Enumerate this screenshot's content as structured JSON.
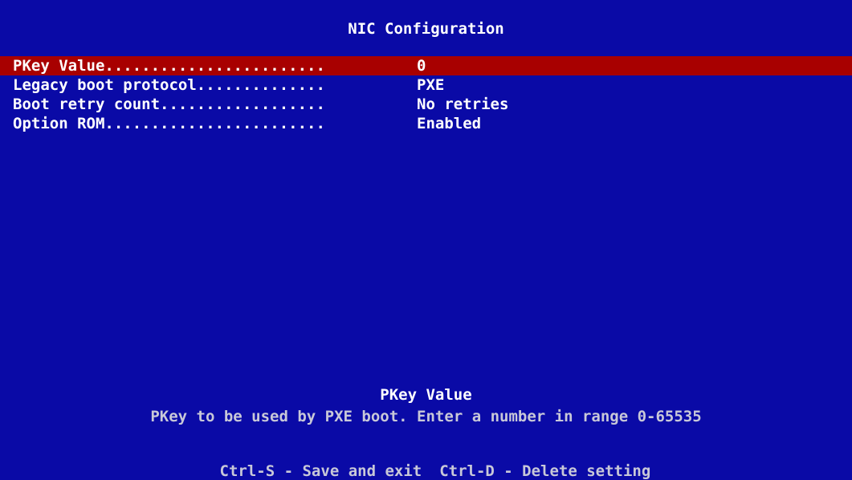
{
  "header": {
    "title": "NIC Configuration"
  },
  "menu": {
    "items": [
      {
        "label": "PKey Value........................",
        "value": "0"
      },
      {
        "label": "Legacy boot protocol..............",
        "value": "PXE"
      },
      {
        "label": "Boot retry count..................",
        "value": "No retries"
      },
      {
        "label": "Option ROM........................",
        "value": "Enabled"
      }
    ],
    "selected_index": 0
  },
  "help": {
    "title": "PKey Value",
    "text": "PKey to be used by PXE boot. Enter a number in range 0-65535"
  },
  "footer": {
    "shortcuts": [
      {
        "label": "Ctrl-S - Save and exit"
      },
      {
        "label": "Ctrl-D - Delete setting"
      }
    ]
  },
  "colors": {
    "background": "#0a0aa6",
    "highlight": "#a80000",
    "text": "#ffffff",
    "dim_text": "#c8c8d8"
  }
}
